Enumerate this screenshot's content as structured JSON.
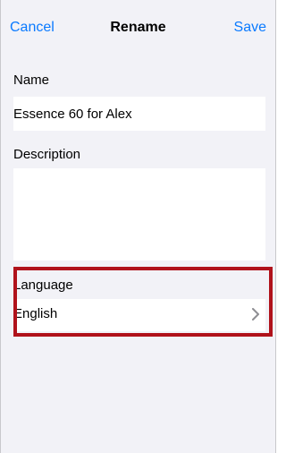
{
  "nav": {
    "cancel_label": "Cancel",
    "title": "Rename",
    "save_label": "Save"
  },
  "form": {
    "name_label": "Name",
    "name_value": "Essence 60 for Alex",
    "description_label": "Description",
    "description_value": "",
    "language_label": "Language",
    "language_value": "English"
  },
  "icons": {
    "language_row": "chevron-right-icon"
  },
  "colors": {
    "accent": "#0a7aff",
    "highlight_border": "#b0121b",
    "background": "#f2f2f7",
    "field_background": "#ffffff"
  }
}
